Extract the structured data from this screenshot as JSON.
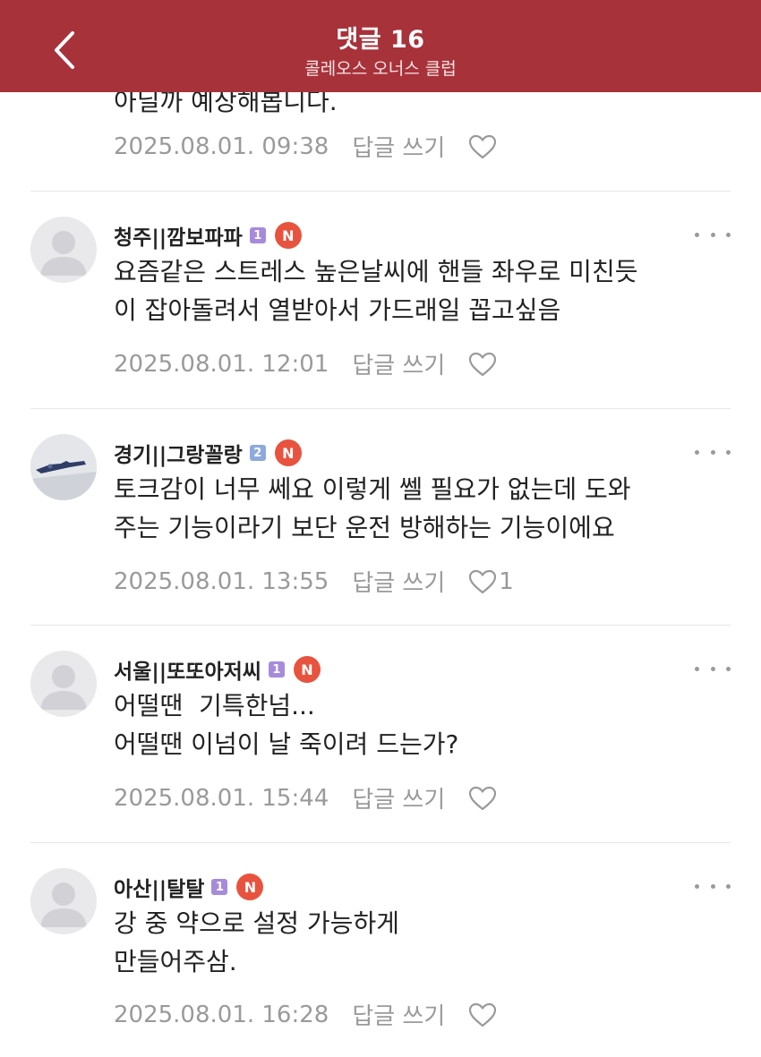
{
  "header": {
    "title": "댓글 16",
    "subtitle": "콜레오스 오너스 클럽"
  },
  "partial_comment": {
    "text": "아닐까 예상해봅니다.",
    "date": "2025.08.01. 09:38",
    "reply_label": "답글 쓰기",
    "likes": ""
  },
  "comments": [
    {
      "author": "청주||깜보파파",
      "level": "1",
      "level_color": "#a78bdb",
      "n_badge": "N",
      "lines": [
        "요즘같은 스트레스 높은날씨에 핸들 좌우로 미친듯",
        "이 잡아돌려서 열받아서 가드래일 꼽고싶음"
      ],
      "date": "2025.08.01. 12:01",
      "reply_label": "답글 쓰기",
      "likes": "",
      "avatar": "default-avatar"
    },
    {
      "author": "경기||그랑꼴랑",
      "level": "2",
      "level_color": "#8ea9dc",
      "n_badge": "N",
      "lines": [
        "토크감이 너무 쎄요 이렇게 쎌 필요가 없는데 도와",
        "주는 기능이라기 보단 운전 방해하는 기능이에요"
      ],
      "date": "2025.08.01. 13:55",
      "reply_label": "답글 쓰기",
      "likes": "1",
      "avatar": "photo-avatar"
    },
    {
      "author": "서울||또또아저씨",
      "level": "1",
      "level_color": "#a78bdb",
      "n_badge": "N",
      "lines": [
        "어떨땐  기특한넘...",
        "어떨땐 이넘이 날 죽이려 드는가?"
      ],
      "date": "2025.08.01. 15:44",
      "reply_label": "답글 쓰기",
      "likes": "",
      "avatar": "default-avatar"
    },
    {
      "author": "아산||탈탈",
      "level": "1",
      "level_color": "#a78bdb",
      "n_badge": "N",
      "lines": [
        "강 중 약으로 설정 가능하게",
        "만들어주삼."
      ],
      "date": "2025.08.01. 16:28",
      "reply_label": "답글 쓰기",
      "likes": "",
      "avatar": "default-avatar"
    }
  ],
  "icons": {
    "back": "chevron-left-icon",
    "like": "heart-outline-icon",
    "more": "more-horizontal-icon"
  },
  "colors": {
    "header_bg": "#a8323a",
    "meta_text": "#9a9a9a",
    "n_badge": "#e8533f"
  }
}
